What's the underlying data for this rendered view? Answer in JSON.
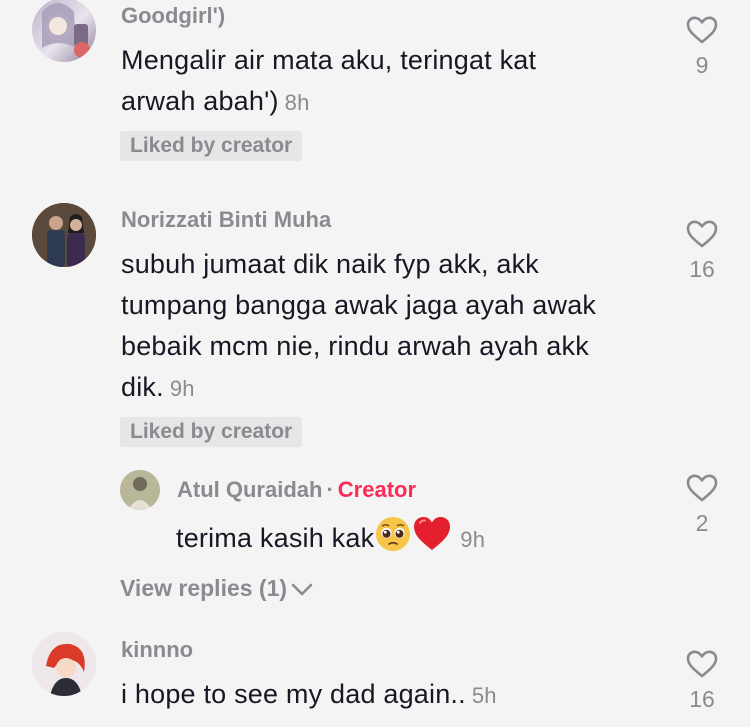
{
  "comments": [
    {
      "username": "Goodgirl')",
      "text": "Mengalir air mata aku, teringat kat arwah abah')",
      "time": "8h",
      "liked_label": "Liked by creator",
      "like_count": "9"
    },
    {
      "username": "Norizzati Binti Muha",
      "text": "subuh jumaat dik naik fyp akk, akk tumpang bangga awak jaga ayah awak bebaik mcm nie, rindu arwah ayah akk dik.",
      "time": "9h",
      "liked_label": "Liked by creator",
      "like_count": "16",
      "reply": {
        "username": "Atul Quraidah",
        "separator": "·",
        "creator_label": "Creator",
        "text": "terima kasih kak",
        "time": "9h",
        "like_count": "2"
      },
      "view_replies": "View replies (1)"
    },
    {
      "username": "kinnno",
      "text": "i hope to see my dad again..",
      "time": "5h",
      "like_count": "16"
    }
  ],
  "icons": {
    "like": "heart-outline-icon",
    "expand": "chevron-down-icon",
    "emoji_1": "pleading-face-emoji",
    "emoji_2": "red-heart-emoji"
  },
  "colors": {
    "creator": "#fe2c55",
    "muted": "#8a8b91",
    "text": "#161823",
    "background": "#f5f4f4"
  }
}
